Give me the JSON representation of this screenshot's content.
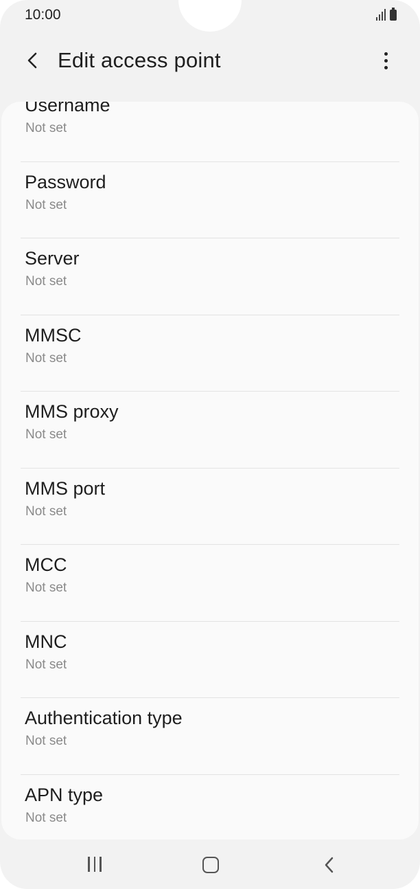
{
  "status_bar": {
    "time": "10:00",
    "icons": [
      "signal-icon",
      "battery-icon"
    ]
  },
  "app_bar": {
    "title": "Edit access point",
    "back_icon": "chevron-left-icon",
    "more_icon": "more-vertical-icon"
  },
  "settings": {
    "items": [
      {
        "label": "Username",
        "value": "Not set"
      },
      {
        "label": "Password",
        "value": "Not set"
      },
      {
        "label": "Server",
        "value": "Not set"
      },
      {
        "label": "MMSC",
        "value": "Not set"
      },
      {
        "label": "MMS proxy",
        "value": "Not set"
      },
      {
        "label": "MMS port",
        "value": "Not set"
      },
      {
        "label": "MCC",
        "value": "Not set"
      },
      {
        "label": "MNC",
        "value": "Not set"
      },
      {
        "label": "Authentication type",
        "value": "Not set"
      },
      {
        "label": "APN type",
        "value": "Not set"
      }
    ]
  },
  "nav_bar": {
    "icons": [
      "recent-apps-icon",
      "home-icon",
      "back-icon"
    ]
  },
  "colors": {
    "background": "#f2f2f2",
    "card": "#fafafa",
    "title_text": "#1e1e1e",
    "secondary_text": "#8a8a8a",
    "divider": "#e3e3e3"
  }
}
